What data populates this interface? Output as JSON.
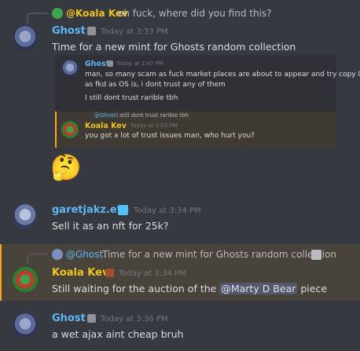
{
  "messages": [
    {
      "reply": {
        "author": "@Koala Kev",
        "text": "oh fuck, where did you find this?"
      },
      "author": "Ghost",
      "timestamp": "Today at 3:33 PM",
      "text": "Time for a new mint for Ghosts random collection",
      "embed": {
        "author": "Ghost",
        "timestamp": "Today at 1:47 PM",
        "lines": [
          "man, so many scam as fuck market places are about to appear and try copy looks",
          "as fkd as OS is, i dont trust any of them",
          "I still dont trust rarible tbh"
        ],
        "inner_reply": {
          "author": "@Ghost",
          "text": "I still dont trust rarible tbh"
        },
        "inner_author": "Koala Kev",
        "inner_timestamp": "Today at 1:51 PM",
        "inner_text": "you got a lot of trust issues man, who hurt you?"
      },
      "emoji": "🤔"
    },
    {
      "author": "garetjakz.eth",
      "timestamp": "Today at 3:34 PM",
      "text": "Sell it as an nft for 25k?"
    },
    {
      "reply": {
        "author": "@Ghost",
        "text": "Time for a new mint for Ghosts random collection"
      },
      "author": "Koala Kev",
      "timestamp": "Today at 3:34 PM",
      "text_before": "Still waiting for the auction of the",
      "mention": "@Marty D Bear",
      "text_after": "piece"
    },
    {
      "author": "Ghost",
      "timestamp": "Today at 3:36 PM",
      "text": "a wet ajax aint cheap bruh"
    }
  ]
}
